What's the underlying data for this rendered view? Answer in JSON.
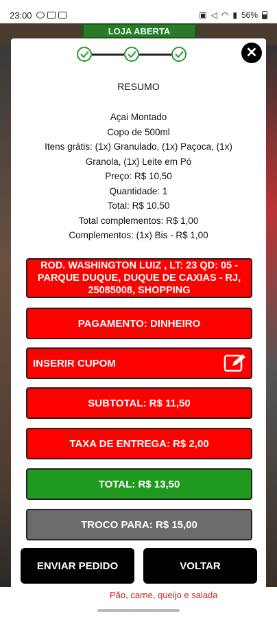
{
  "status_bar": {
    "time": "23:00",
    "battery": "56%",
    "icons": [
      "whatsapp-icon",
      "notification-icon",
      "notification-icon",
      "lock-icon",
      "mute-icon",
      "wifi-icon",
      "signal-icon",
      "battery-icon"
    ]
  },
  "background": {
    "badge": "LOJA ABERTA",
    "bottom_text": "Pão, carne, queijo e salada"
  },
  "modal": {
    "close_icon": "close-icon",
    "steps": [
      "check-icon",
      "check-icon",
      "check-icon"
    ],
    "title": "RESUMO",
    "summary": {
      "product": "Açai Montado",
      "size": "Copo de 500ml",
      "free_items": "Itens grátis: (1x) Granulado, (1x) Paçoca, (1x) Granola, (1x) Leite em Pó",
      "price": "Preço: R$ 10,50",
      "quantity": "Quantidade: 1",
      "total": "Total: R$ 10,50",
      "complements_total": "Total complementos: R$ 1,00",
      "complements": "Complementos: (1x) Bis - R$ 1,00"
    },
    "address": "ROD. WASHINGTON LUIZ , LT: 23 QD: 05 - PARQUE DUQUE, DUQUE DE CAXIAS - RJ, 25085008, SHOPPING",
    "payment": "PAGAMENTO: DINHEIRO",
    "coupon": "INSERIR CUPOM",
    "coupon_icon": "edit-icon",
    "subtotal": "SUBTOTAL: R$ 11,50",
    "delivery_fee": "TAXA DE ENTREGA: R$ 2,00",
    "total": "TOTAL: R$ 13,50",
    "change_for": "TROCO PARA: R$ 15,00",
    "send_button": "ENVIAR PEDIDO",
    "back_button": "VOLTAR"
  },
  "colors": {
    "red": "#ff0000",
    "green": "#1f9a1f",
    "gray": "#6c6c6c",
    "step_green": "#2a9a2a"
  }
}
